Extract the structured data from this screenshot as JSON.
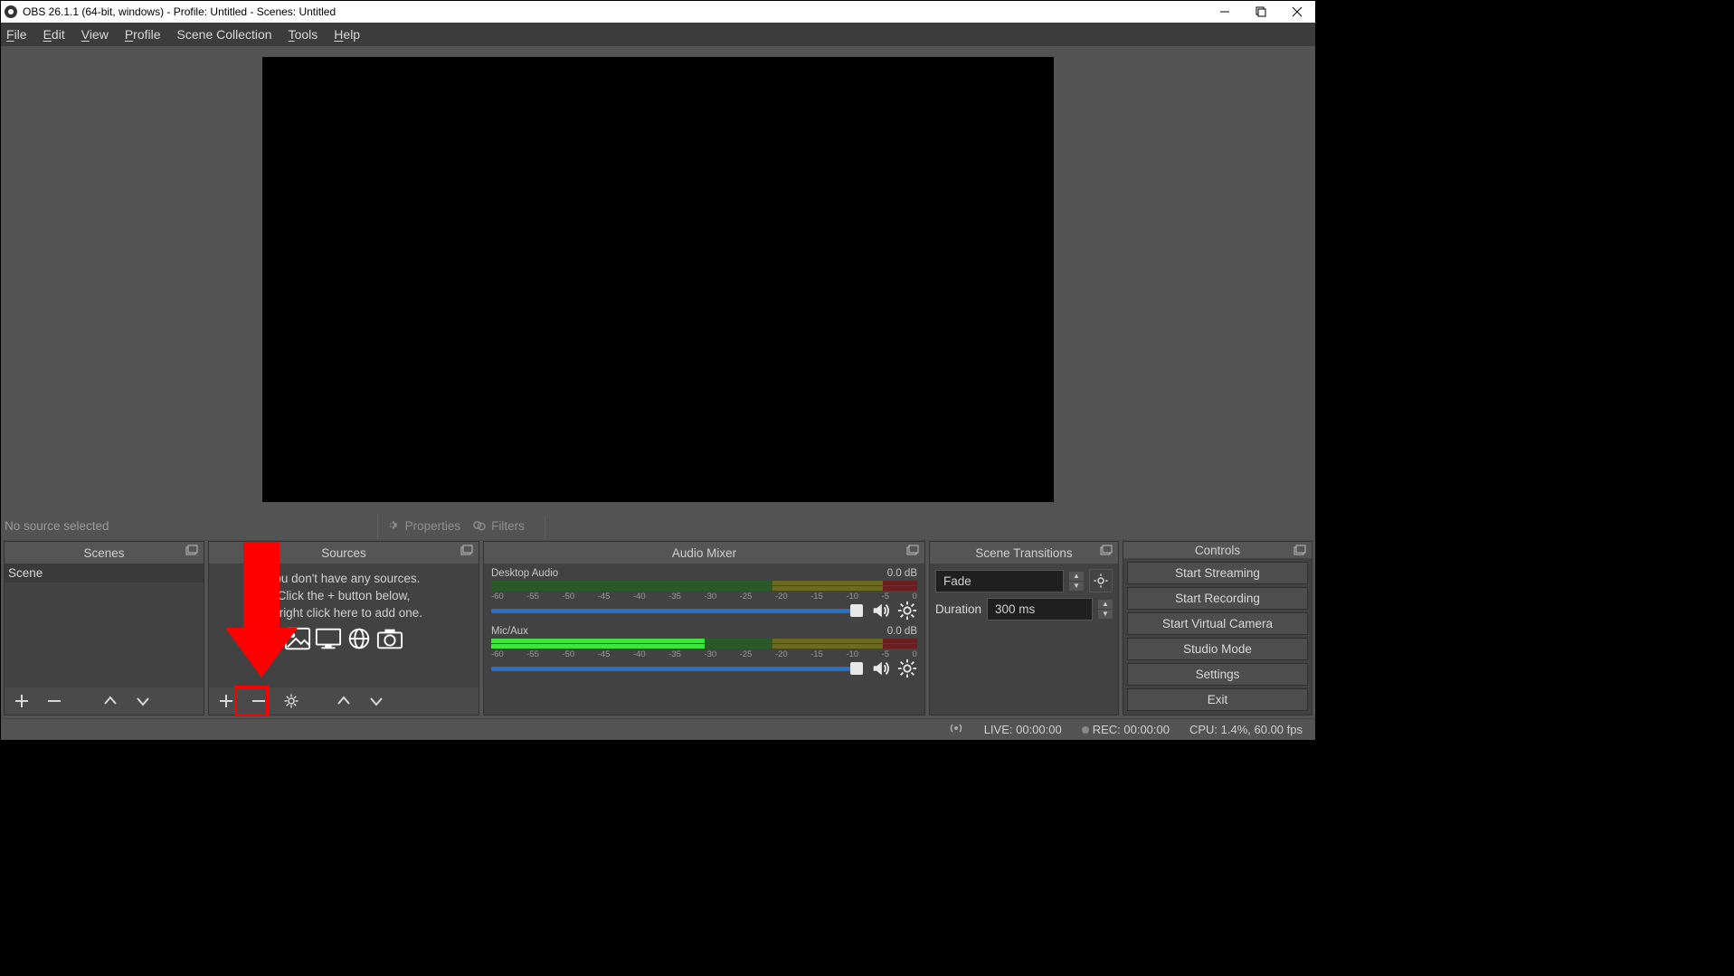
{
  "titlebar": {
    "text": "OBS 26.1.1 (64-bit, windows) - Profile: Untitled - Scenes: Untitled"
  },
  "menu": {
    "file": "File",
    "edit": "Edit",
    "view": "View",
    "profile": "Profile",
    "scene_collection": "Scene Collection",
    "tools": "Tools",
    "help": "Help"
  },
  "src_toolbar": {
    "no_source": "No source selected",
    "properties": "Properties",
    "filters": "Filters"
  },
  "docks": {
    "scenes": {
      "title": "Scenes",
      "items": [
        "Scene"
      ]
    },
    "sources": {
      "title": "Sources",
      "empty_line1": "You don't have any sources.",
      "empty_line2": "Click the + button below,",
      "empty_line3": "or right click here to add one."
    },
    "mixer": {
      "title": "Audio Mixer",
      "channels": [
        {
          "name": "Desktop Audio",
          "level": "0.0 dB"
        },
        {
          "name": "Mic/Aux",
          "level": "0.0 dB"
        }
      ],
      "ticks": [
        "-60",
        "-55",
        "-50",
        "-45",
        "-40",
        "-35",
        "-30",
        "-25",
        "-20",
        "-15",
        "-10",
        "-5",
        "0"
      ]
    },
    "transitions": {
      "title": "Scene Transitions",
      "selected": "Fade",
      "dur_label": "Duration",
      "dur_value": "300 ms"
    },
    "controls": {
      "title": "Controls",
      "buttons": [
        "Start Streaming",
        "Start Recording",
        "Start Virtual Camera",
        "Studio Mode",
        "Settings",
        "Exit"
      ]
    }
  },
  "status": {
    "live": "LIVE: 00:00:00",
    "rec": "REC: 00:00:00",
    "cpu": "CPU: 1.4%, 60.00 fps"
  }
}
